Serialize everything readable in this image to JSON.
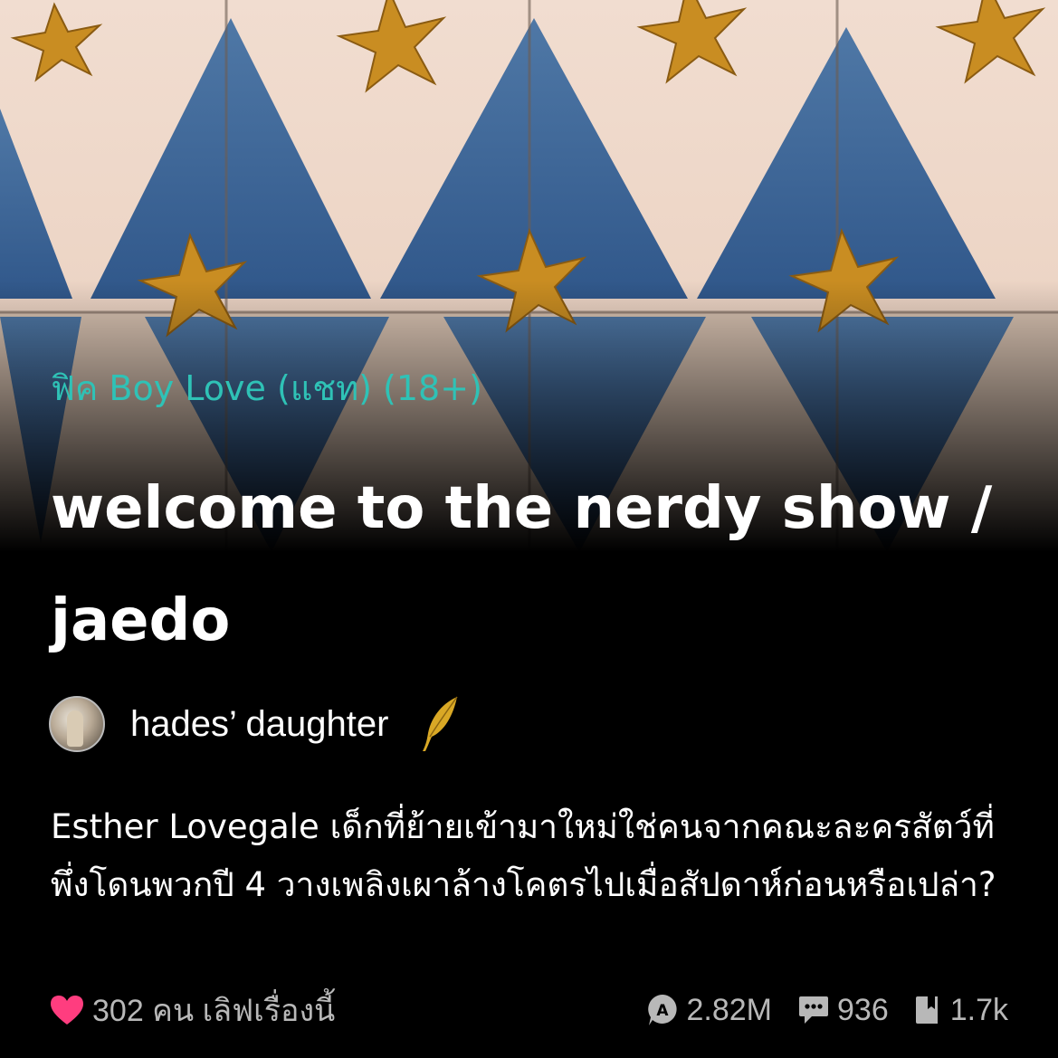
{
  "story": {
    "category": "ฟิค Boy Love (แชท) (18+)",
    "title": "welcome to the nerdy show / jaedo",
    "author": "hades’ daughter",
    "description": "Esther Lovegale เด็กที่ย้ายเข้ามาใหม่ใช่คนจากคณะละครสัตว์ที่พึ่งโดนพวกปี 4 วางเพลิงเผาล้างโคตรไปเมื่อสัปดาห์ก่อนหรือเปล่า?"
  },
  "stats": {
    "likes": "302 คน เลิฟเรื่องนี้",
    "reads": "2.82M",
    "comments": "936",
    "chapters": "1.7k"
  },
  "colors": {
    "category": "#2fc2b6",
    "heart": "#ff3d7f",
    "quill": "#d9a825",
    "stat_text": "#b8b8b8"
  },
  "icons": [
    "heart-icon",
    "read-count-icon",
    "comment-icon",
    "chapter-icon",
    "quill-icon"
  ]
}
